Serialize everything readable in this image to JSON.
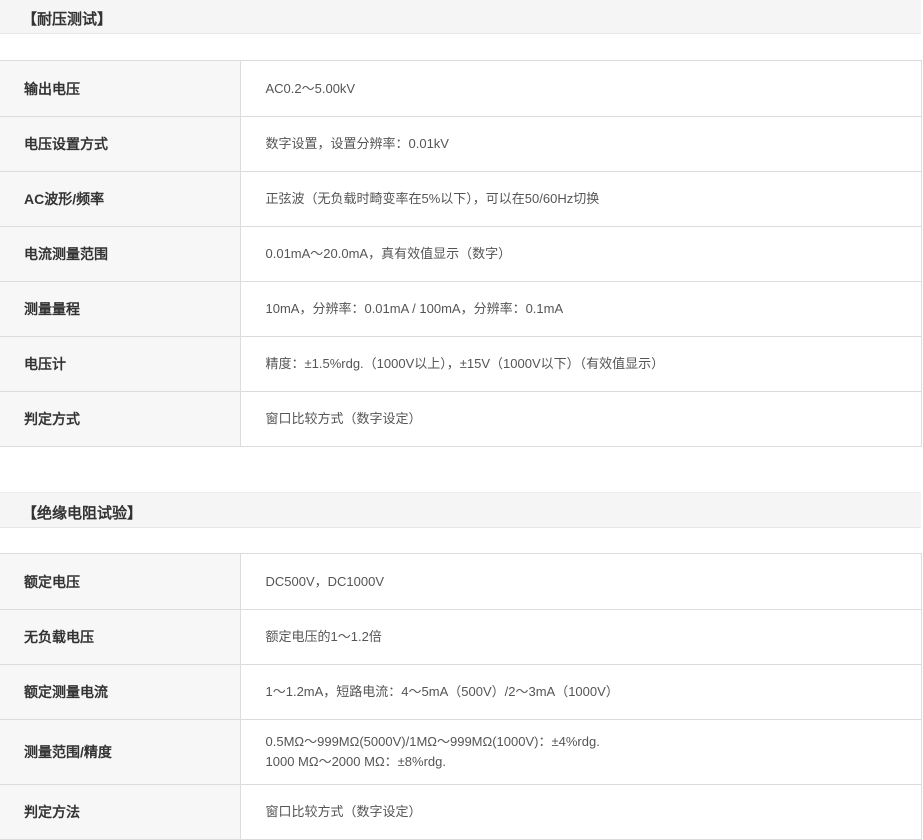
{
  "sections": [
    {
      "title": "【耐压测试】",
      "rows": [
        {
          "label": "输出电压",
          "value": [
            "AC0.2～5.00kV"
          ]
        },
        {
          "label": "电压设置方式",
          "value": [
            "数字设置，设置分辨率：0.01kV"
          ]
        },
        {
          "label": "AC波形/频率",
          "value": [
            "正弦波（无负载时畸变率在5%以下），可以在50/60Hz切换"
          ]
        },
        {
          "label": "电流测量范围",
          "value": [
            "0.01mA～20.0mA，真有效值显示（数字）"
          ]
        },
        {
          "label": "测量量程",
          "value": [
            "10mA，分辨率：0.01mA / 100mA，分辨率：0.1mA"
          ]
        },
        {
          "label": "电压计",
          "value": [
            "精度：±1.5%rdg.（1000V以上），±15V（1000V以下）（有效值显示）"
          ]
        },
        {
          "label": "判定方式",
          "value": [
            "窗口比较方式（数字设定）"
          ]
        }
      ]
    },
    {
      "title": "【绝缘电阻试验】",
      "rows": [
        {
          "label": "额定电压",
          "value": [
            "DC500V，DC1000V"
          ]
        },
        {
          "label": "无负载电压",
          "value": [
            "额定电压的1～1.2倍"
          ]
        },
        {
          "label": "额定测量电流",
          "value": [
            "1～1.2mA，短路电流：4～5mA（500V）/2～3mA（1000V）"
          ]
        },
        {
          "label": "测量范围/精度",
          "value": [
            "0.5MΩ～999MΩ(5000V)/1MΩ～999MΩ(1000V)：±4%rdg.",
            "1000 MΩ～2000 MΩ：±8%rdg."
          ]
        },
        {
          "label": "判定方法",
          "value": [
            "窗口比较方式（数字设定）"
          ]
        }
      ]
    }
  ]
}
